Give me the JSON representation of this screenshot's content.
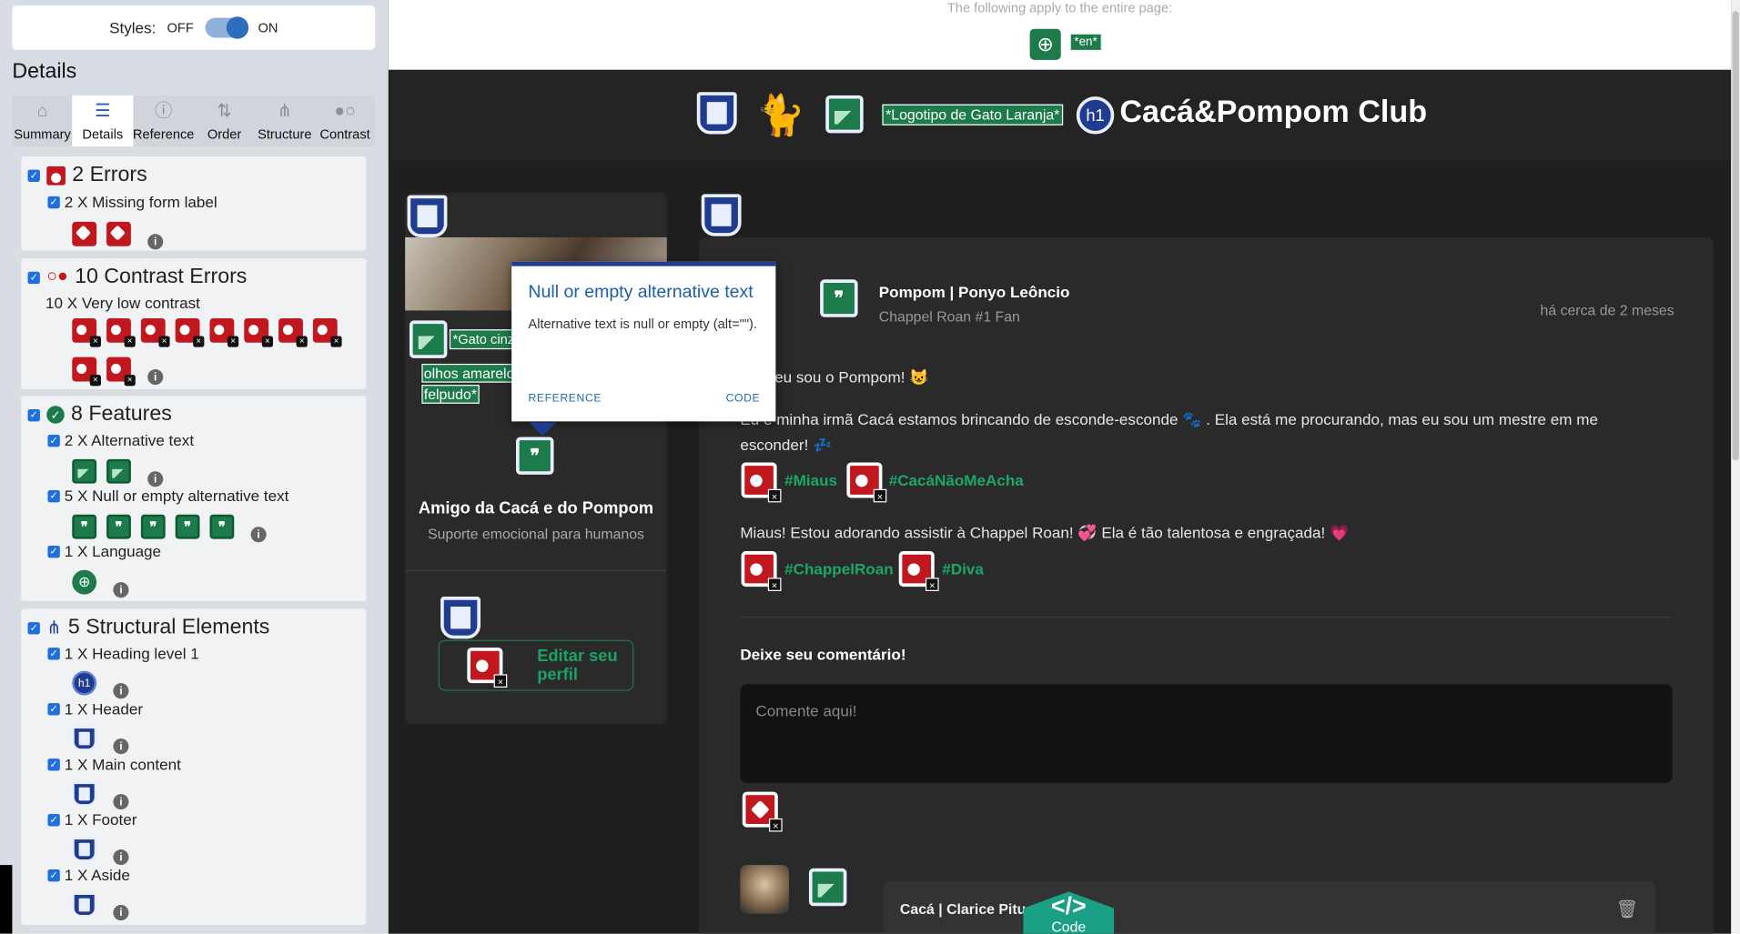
{
  "sidebar": {
    "styles_label": "Styles:",
    "off_label": "OFF",
    "on_label": "ON",
    "details_title": "Details",
    "tabs": [
      {
        "label": "Summary",
        "icon": "home-icon"
      },
      {
        "label": "Details",
        "icon": "list-icon"
      },
      {
        "label": "Reference",
        "icon": "info-icon"
      },
      {
        "label": "Order",
        "icon": "order-icon"
      },
      {
        "label": "Structure",
        "icon": "structure-icon"
      },
      {
        "label": "Contrast",
        "icon": "contrast-icon"
      }
    ],
    "errors": {
      "title": "2 Errors",
      "item": "2 X Missing form label"
    },
    "contrast": {
      "title": "10 Contrast Errors",
      "item": "10 X Very low contrast"
    },
    "features": {
      "title": "8 Features",
      "items": [
        "2 X Alternative text",
        "5 X Null or empty alternative text",
        "1 X Language"
      ]
    },
    "structural": {
      "title": "5 Structural Elements",
      "items": [
        "1 X Heading level 1",
        "1 X Header",
        "1 X Main content",
        "1 X Footer",
        "1 X Aside"
      ]
    }
  },
  "page": {
    "top_note": "The following apply to the entire page:",
    "lang_tag": "*en*",
    "logo_alt": "*Logotipo de Gato Laranja*",
    "h1_badge": "h1",
    "site_title": "Cacá&Pompom Club",
    "left_card": {
      "alt_text_1": "*Gato cinz",
      "alt_text_2": "olhos amarelos e",
      "alt_text_3": "felpudo*",
      "name": "Amigo da Cacá e do Pompom",
      "subtitle": "Suporte emocional para humanos",
      "edit_label": "Editar seu perfil"
    },
    "post": {
      "author": "Pompom | Ponyo Leôncio",
      "author_sub": "Chappel Roan #1 Fan",
      "time": "há cerca de 2 meses",
      "line1": "eu sou o Pompom! 😺",
      "line2": "Eu e minha irmã Cacá estamos brincando de esconde-esconde 🐾 . Ela está me procurando, mas eu sou um mestre em me esconder! 💤",
      "tags1": [
        "#Miaus",
        "#CacáNãoMeAcha"
      ],
      "line3": "Miaus! Estou adorando assistir à Chappel Roan! 💞 Ela é tão talentosa e engraçada! 💗",
      "tags2": [
        "#ChappelRoan",
        "#Diva"
      ]
    },
    "comment": {
      "title": "Deixe seu comentário!",
      "placeholder": "Comente aqui!"
    },
    "reply_name": "Cacá | Clarice Pituc",
    "code_button": "</>",
    "code_label": "Code"
  },
  "popup": {
    "title": "Null or empty alternative text",
    "description": "Alternative text is null or empty (alt=\"\").",
    "reference": "REFERENCE",
    "code": "CODE"
  },
  "colors": {
    "error": "#c0181e",
    "feature": "#1d7a4a",
    "structure": "#1f3c8f",
    "accent": "#1aa86a"
  }
}
